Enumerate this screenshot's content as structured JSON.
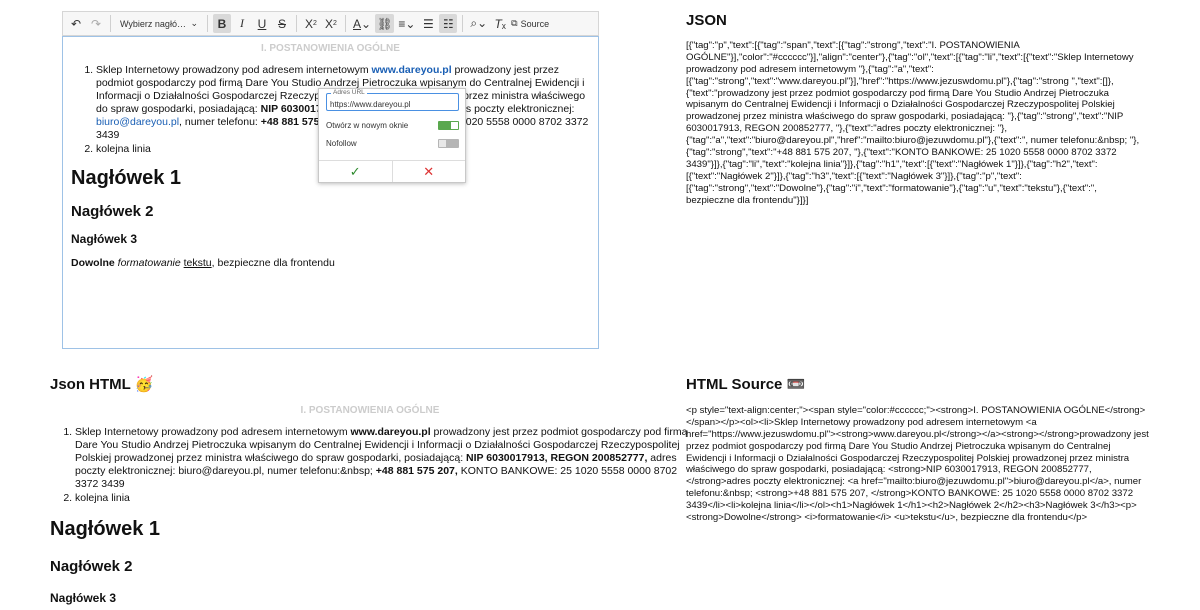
{
  "toolbar": {
    "format_select": "Wybierz nagłó…",
    "source_label": "Source"
  },
  "document": {
    "title": "I. POSTANOWIENIA OGÓLNE",
    "item1_prefix": "Sklep Internetowy prowadzony pod adresem internetowym ",
    "item1_link": "www.dareyou.pl",
    "item1_middle": " prowadzony jest przez podmiot gospodarczy pod firmą Dare You Studio Andrzej Pietroczuka wpisanym do Centralnej Ewidencji i Informacji o Działalności Gospodarczej Rzeczypospolitej Polskiej prowadzonej przez ministra właściwego do spraw gospodarki, posiadającą: ",
    "item1_nip": "NIP 6030017913, REGON 200852777,",
    "item1_email_prefix": " adres poczty elektronicznej: ",
    "item1_email": "biuro@dareyou.pl",
    "item1_phone_prefix": ", numer telefonu:  ",
    "item1_phone": "+48 881 575 207,",
    "item1_bank": " KONTO BANKOWE: 25 1020 5558 0000 8702 3372 3439",
    "item1_phone_prefix_rendered": ", numer telefonu:&nbsp; ",
    "item2": "kolejna linia",
    "h1": "Nagłówek 1",
    "h2": "Nagłówek 2",
    "h3": "Nagłówek 3",
    "p_strong": "Dowolne",
    "p_italic": "formatowanie",
    "p_underline": "tekstu",
    "p_rest": ", bezpieczne dla frontendu"
  },
  "popup": {
    "url_label": "Adres URL",
    "url_value": "https://www.dareyou.pl",
    "new_window_label": "Otwórz w nowym oknie",
    "new_window_on": true,
    "nofollow_label": "Nofollow",
    "nofollow_on": false,
    "ok_icon": "check-icon",
    "cancel_icon": "close-icon"
  },
  "sections": {
    "json_title": "JSON",
    "json_html_title": "Json HTML",
    "json_html_emoji": "🥳",
    "html_source_title": "HTML Source",
    "html_source_emoji": "📼"
  },
  "json_text": "[{\"tag\":\"p\",\"text\":[{\"tag\":\"span\",\"text\":[{\"tag\":\"strong\",\"text\":\"I. POSTANOWIENIA OGÓLNE\"}],\"color\":\"#cccccc\"}],\"align\":\"center\"},{\"tag\":\"ol\",\"text\":[{\"tag\":\"li\",\"text\":[{\"text\":\"Sklep Internetowy prowadzony pod adresem internetowym \"},{\"tag\":\"a\",\"text\":[{\"tag\":\"strong\",\"text\":\"www.dareyou.pl\"}],\"href\":\"https://www.jezuswdomu.pl\"},{\"tag\":\"strong \",\"text\":[]},{\"text\":\"prowadzony jest przez podmiot gospodarczy pod firmą Dare You Studio Andrzej Pietroczuka wpisanym do Centralnej Ewidencji i Informacji o Działalności Gospodarczej Rzeczypospolitej Polskiej prowadzonej przez ministra właściwego do spraw gospodarki, posiadającą: \"},{\"tag\":\"strong\",\"text\":\"NIP 6030017913, REGON 200852777, \"},{\"text\":\"adres poczty elektronicznej: \"},{\"tag\":\"a\",\"text\":\"biuro@dareyou.pl\",\"href\":\"mailto:biuro@jezuwdomu.pl\"},{\"text\":\", numer telefonu:&nbsp; \"},{\"tag\":\"strong\",\"text\":\"+48 881 575 207, \"},{\"text\":\"KONTO BANKOWE: 25 1020 5558 0000 8702 3372 3439\"}]},{\"tag\":\"li\",\"text\":\"kolejna linia\"}]},{\"tag\":\"h1\",\"text\":[{\"text\":\"Nagłówek 1\"}]},{\"tag\":\"h2\",\"text\":[{\"text\":\"Nagłówek 2\"}]},{\"tag\":\"h3\",\"text\":[{\"text\":\"Nagłówek 3\"}]},{\"tag\":\"p\",\"text\":[{\"tag\":\"strong\",\"text\":\"Dowolne\"},{\"tag\":\"i\",\"text\":\"formatowanie\"},{\"tag\":\"u\",\"text\":\"tekstu\"},{\"text\":\", bezpieczne dla frontendu\"}]}]",
  "html_source_text": "<p style=\"text-align:center;\"><span style=\"color:#cccccc;\"><strong>I. POSTANOWIENIA OGÓLNE</strong></span></p><ol><li>Sklep Internetowy prowadzony pod adresem internetowym <a href=\"https://www.jezuswdomu.pl\"><strong>www.dareyou.pl</strong></a><strong></strong>prowadzony jest przez podmiot gospodarczy pod firmą Dare You Studio Andrzej Pietroczuka wpisanym do Centralnej Ewidencji i Informacji o Działalności Gospodarczej Rzeczypospolitej Polskiej prowadzonej przez ministra właściwego do spraw gospodarki, posiadającą: <strong>NIP 6030017913, REGON 200852777, </strong>adres poczty elektronicznej: <a href=\"mailto:biuro@jezuwdomu.pl\">biuro@dareyou.pl</a>, numer telefonu:&nbsp; <strong>+48 881 575 207, </strong>KONTO BANKOWE: 25 1020 5558 0000 8702 3372 3439</li><li>kolejna linia</li></ol><h1>Nagłówek 1</h1><h2>Nagłówek 2</h2><h3>Nagłówek 3</h3><p><strong>Dowolne</strong> <i>formatowanie</i> <u>tekstu</u>, bezpieczne dla frontendu</p>"
}
